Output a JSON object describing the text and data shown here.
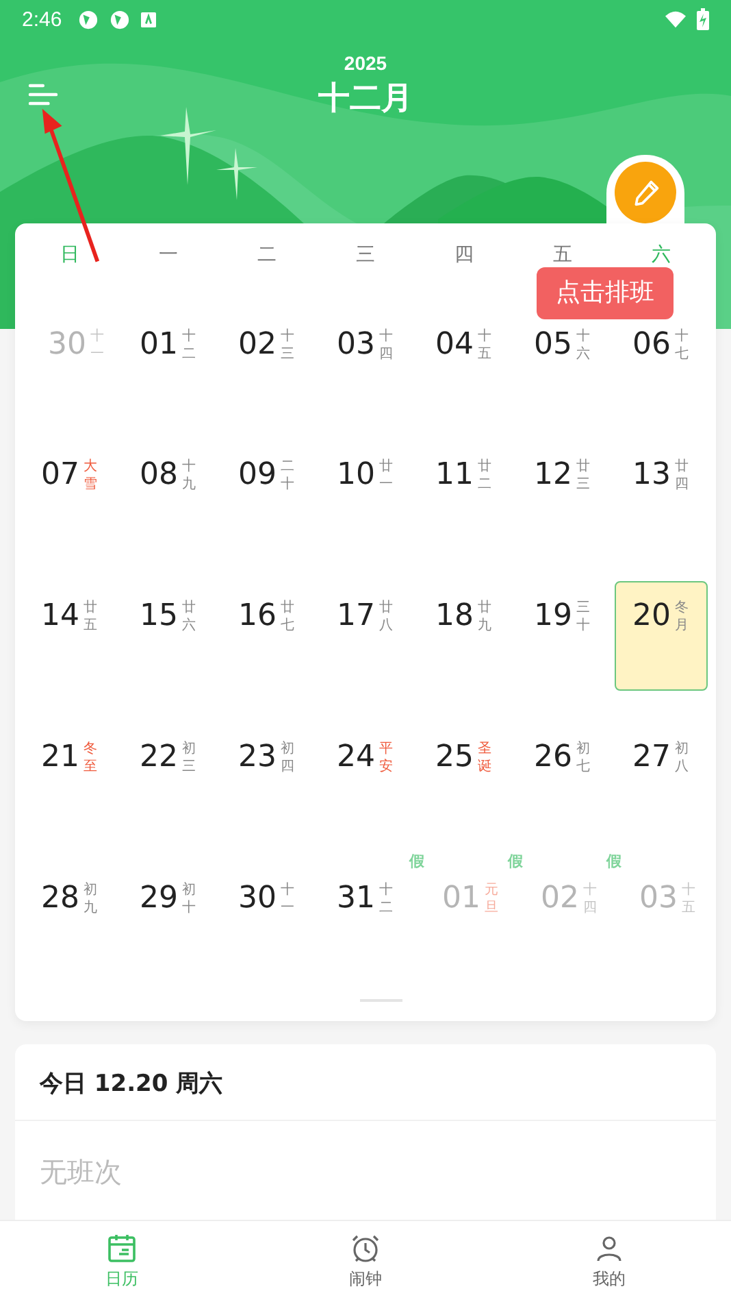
{
  "status_bar": {
    "time": "2:46"
  },
  "header": {
    "year": "2025",
    "month": "十二月"
  },
  "tooltip": "点击排班",
  "weekdays": [
    {
      "label": "日",
      "weekend": true
    },
    {
      "label": "一",
      "weekend": false
    },
    {
      "label": "二",
      "weekend": false
    },
    {
      "label": "三",
      "weekend": false
    },
    {
      "label": "四",
      "weekend": false
    },
    {
      "label": "五",
      "weekend": false
    },
    {
      "label": "六",
      "weekend": true
    }
  ],
  "weeks": [
    [
      {
        "day": "30",
        "lunar": "十一",
        "red": false,
        "other_month": true,
        "selected": false
      },
      {
        "day": "01",
        "lunar": "十二",
        "red": false,
        "other_month": false,
        "selected": false
      },
      {
        "day": "02",
        "lunar": "十三",
        "red": false,
        "other_month": false,
        "selected": false
      },
      {
        "day": "03",
        "lunar": "十四",
        "red": false,
        "other_month": false,
        "selected": false
      },
      {
        "day": "04",
        "lunar": "十五",
        "red": false,
        "other_month": false,
        "selected": false
      },
      {
        "day": "05",
        "lunar": "十六",
        "red": false,
        "other_month": false,
        "selected": false
      },
      {
        "day": "06",
        "lunar": "十七",
        "red": false,
        "other_month": false,
        "selected": false
      }
    ],
    [
      {
        "day": "07",
        "lunar": "大雪",
        "red": true,
        "other_month": false,
        "selected": false
      },
      {
        "day": "08",
        "lunar": "十九",
        "red": false,
        "other_month": false,
        "selected": false
      },
      {
        "day": "09",
        "lunar": "二十",
        "red": false,
        "other_month": false,
        "selected": false
      },
      {
        "day": "10",
        "lunar": "廿一",
        "red": false,
        "other_month": false,
        "selected": false
      },
      {
        "day": "11",
        "lunar": "廿二",
        "red": false,
        "other_month": false,
        "selected": false
      },
      {
        "day": "12",
        "lunar": "廿三",
        "red": false,
        "other_month": false,
        "selected": false
      },
      {
        "day": "13",
        "lunar": "廿四",
        "red": false,
        "other_month": false,
        "selected": false
      }
    ],
    [
      {
        "day": "14",
        "lunar": "廿五",
        "red": false,
        "other_month": false,
        "selected": false
      },
      {
        "day": "15",
        "lunar": "廿六",
        "red": false,
        "other_month": false,
        "selected": false
      },
      {
        "day": "16",
        "lunar": "廿七",
        "red": false,
        "other_month": false,
        "selected": false
      },
      {
        "day": "17",
        "lunar": "廿八",
        "red": false,
        "other_month": false,
        "selected": false
      },
      {
        "day": "18",
        "lunar": "廿九",
        "red": false,
        "other_month": false,
        "selected": false
      },
      {
        "day": "19",
        "lunar": "三十",
        "red": false,
        "other_month": false,
        "selected": false
      },
      {
        "day": "20",
        "lunar": "冬月",
        "red": false,
        "other_month": false,
        "selected": true
      }
    ],
    [
      {
        "day": "21",
        "lunar": "冬至",
        "red": true,
        "other_month": false,
        "selected": false
      },
      {
        "day": "22",
        "lunar": "初三",
        "red": false,
        "other_month": false,
        "selected": false
      },
      {
        "day": "23",
        "lunar": "初四",
        "red": false,
        "other_month": false,
        "selected": false
      },
      {
        "day": "24",
        "lunar": "平安",
        "red": true,
        "other_month": false,
        "selected": false
      },
      {
        "day": "25",
        "lunar": "圣诞",
        "red": true,
        "other_month": false,
        "selected": false
      },
      {
        "day": "26",
        "lunar": "初七",
        "red": false,
        "other_month": false,
        "selected": false
      },
      {
        "day": "27",
        "lunar": "初八",
        "red": false,
        "other_month": false,
        "selected": false
      }
    ],
    [
      {
        "day": "28",
        "lunar": "初九",
        "red": false,
        "other_month": false,
        "selected": false
      },
      {
        "day": "29",
        "lunar": "初十",
        "red": false,
        "other_month": false,
        "selected": false
      },
      {
        "day": "30",
        "lunar": "十一",
        "red": false,
        "other_month": false,
        "selected": false
      },
      {
        "day": "31",
        "lunar": "十二",
        "red": false,
        "other_month": false,
        "selected": false
      },
      {
        "day": "01",
        "lunar": "元旦",
        "red": true,
        "other_month": true,
        "selected": false,
        "badge": "假"
      },
      {
        "day": "02",
        "lunar": "十四",
        "red": false,
        "other_month": true,
        "selected": false,
        "badge": "假"
      },
      {
        "day": "03",
        "lunar": "十五",
        "red": false,
        "other_month": true,
        "selected": false,
        "badge": "假"
      }
    ]
  ],
  "today": {
    "title": "今日 12.20 周六",
    "empty": "无班次"
  },
  "nav": [
    {
      "label": "日历",
      "kind": "calendar",
      "selected": true
    },
    {
      "label": "闹钟",
      "kind": "alarm",
      "selected": false
    },
    {
      "label": "我的",
      "kind": "person",
      "selected": false
    }
  ]
}
